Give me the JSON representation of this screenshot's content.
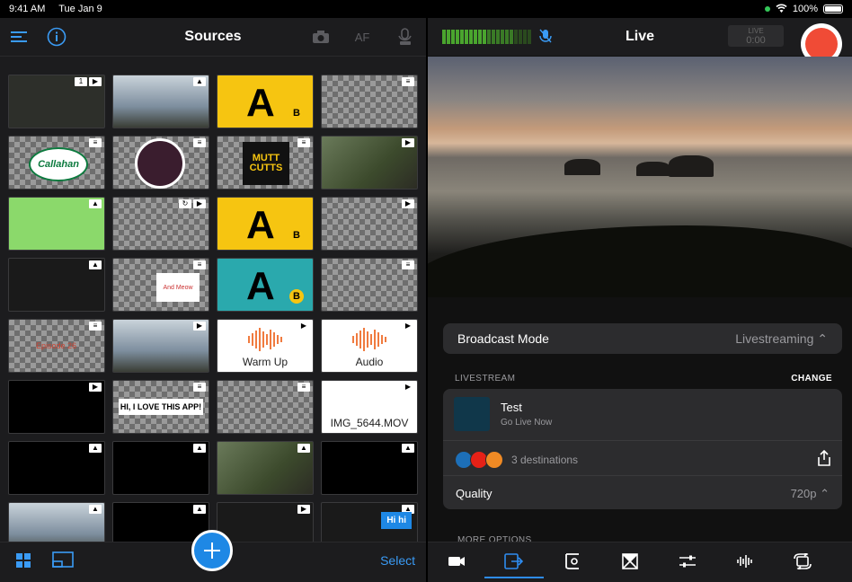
{
  "status_bar": {
    "time": "9:41 AM",
    "date": "Tue Jan 9",
    "battery": "100%"
  },
  "sources": {
    "title": "Sources",
    "af_label": "AF",
    "tiles": [
      {
        "bg": "dark",
        "badges": [
          "1",
          "cam"
        ]
      },
      {
        "bg": "sky",
        "badges": [
          "img"
        ]
      },
      {
        "bg": "yellow",
        "badges": [],
        "big": "A",
        "b": "B"
      },
      {
        "bg": "checker",
        "badges": [
          "layers"
        ]
      },
      {
        "bg": "checker",
        "badges": [
          "layers"
        ],
        "callahan": "Callahan"
      },
      {
        "bg": "checker",
        "badges": [
          "layers"
        ],
        "logo": true
      },
      {
        "bg": "checker",
        "badges": [
          "layers"
        ],
        "mutt": "MUTT CUTTS"
      },
      {
        "bg": "photo",
        "badges": [
          "play"
        ]
      },
      {
        "bg": "green",
        "badges": [
          "img"
        ]
      },
      {
        "bg": "checker",
        "badges": [
          "loop",
          "play"
        ]
      },
      {
        "bg": "yellow",
        "badges": [],
        "big": "A",
        "b": "B"
      },
      {
        "bg": "checker",
        "badges": [
          "play"
        ]
      },
      {
        "bg": "shots",
        "badges": [
          "img"
        ]
      },
      {
        "bg": "checker",
        "badges": [
          "layers"
        ],
        "sign": "And Meow"
      },
      {
        "bg": "teal",
        "badges": [],
        "big": "A",
        "b": "B"
      },
      {
        "bg": "checker",
        "badges": [
          "layers"
        ]
      },
      {
        "bg": "checker",
        "badges": [
          "layers"
        ],
        "redlabel": "Episode 26"
      },
      {
        "bg": "sky",
        "badges": [
          "play"
        ]
      },
      {
        "bg": "white",
        "badges": [
          "play"
        ],
        "wave": true,
        "text": "Warm Up"
      },
      {
        "bg": "white",
        "badges": [
          "play"
        ],
        "wave": true,
        "text": "Audio"
      },
      {
        "bg": "black",
        "badges": [
          "play"
        ]
      },
      {
        "bg": "checker",
        "badges": [
          "layers"
        ],
        "banner": "HI, I LOVE THIS APP!"
      },
      {
        "bg": "checker",
        "badges": [
          "layers"
        ]
      },
      {
        "bg": "white",
        "badges": [
          "play"
        ],
        "text": "IMG_5644.MOV"
      },
      {
        "bg": "black",
        "badges": [
          "img"
        ]
      },
      {
        "bg": "black",
        "badges": [
          "img"
        ]
      },
      {
        "bg": "photo",
        "badges": [
          "img"
        ]
      },
      {
        "bg": "black",
        "badges": [
          "img"
        ]
      },
      {
        "bg": "sky",
        "badges": [
          "img"
        ]
      },
      {
        "bg": "black",
        "badges": [
          "img"
        ]
      },
      {
        "bg": "shots",
        "badges": [
          "play"
        ]
      },
      {
        "bg": "shots",
        "badges": [
          "img"
        ],
        "hi": "Hi hi"
      }
    ],
    "select_label": "Select"
  },
  "live": {
    "title": "Live",
    "live_badge": "LIVE",
    "live_timer": "0:00",
    "broadcast_mode_label": "Broadcast Mode",
    "broadcast_mode_value": "Livestreaming",
    "livestream_header": "LIVESTREAM",
    "change_label": "CHANGE",
    "stream_name": "Test",
    "stream_sub": "Go Live Now",
    "destinations": "3 destinations",
    "quality_label": "Quality",
    "quality_value": "720p",
    "more_options": "MORE OPTIONS",
    "dest_colors": [
      "#1d6fb8",
      "#e62117",
      "#f08a24"
    ]
  },
  "colors": {
    "accent": "#2e8cf0",
    "record": "#f04b36",
    "select": "#3a9bf5"
  },
  "icons": {
    "left_header": [
      "menu-icon",
      "info-icon",
      "camera-icon",
      "af-icon",
      "mic-settings-icon"
    ],
    "tabs": [
      "camera-tab-icon",
      "output-tab-icon",
      "transitions-tab-icon",
      "overlay-tab-icon",
      "adjust-tab-icon",
      "audio-tab-icon",
      "switch-tab-icon"
    ]
  }
}
